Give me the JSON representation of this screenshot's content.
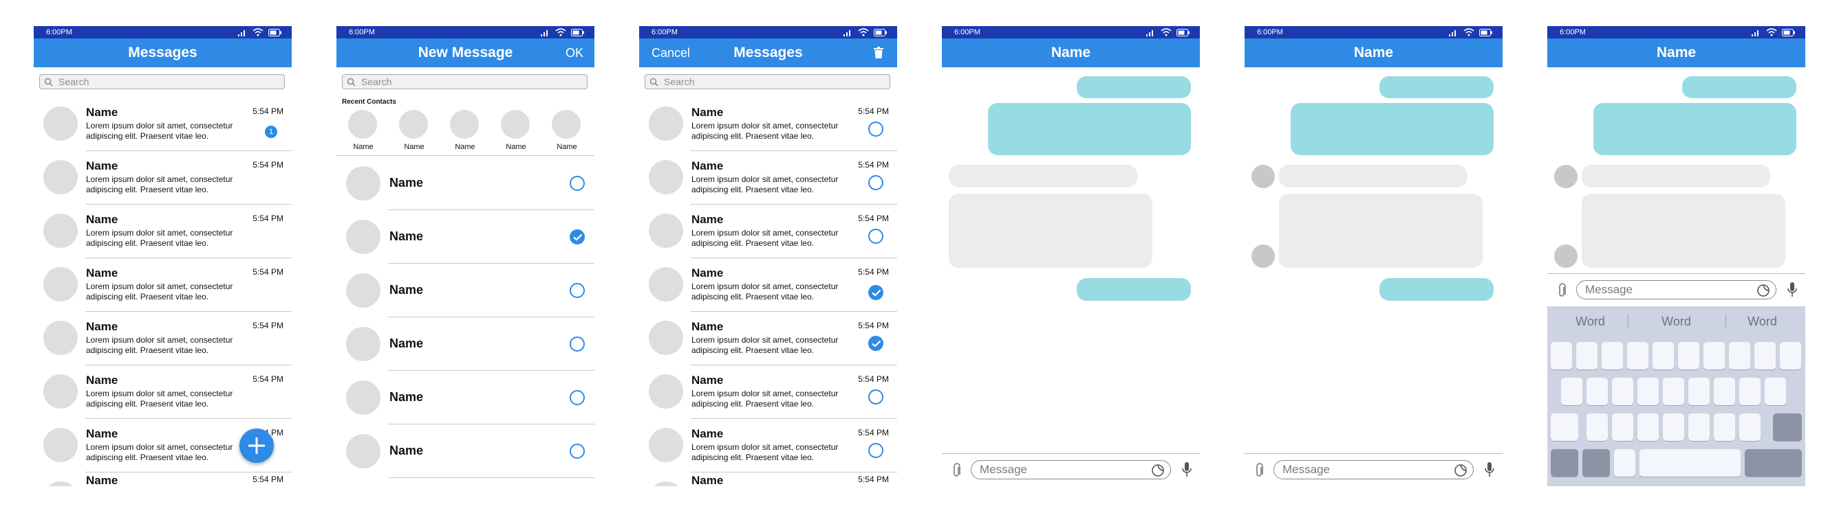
{
  "colors": {
    "statusbar": "#1b3ab0",
    "titlebar": "#2f8ae6",
    "accent": "#2f8ae6",
    "outgoing_bubble": "#97dbe3",
    "incoming_bubble": "#ececec",
    "avatar": "#dedede",
    "keyboard": "#cdd3e2"
  },
  "status": {
    "time": "6:00PM",
    "icons": [
      "signal-icon",
      "wifi-icon",
      "battery-icon"
    ]
  },
  "screen1": {
    "title": "Messages",
    "search_placeholder": "Search",
    "conversations": [
      {
        "name": "Name",
        "snippet": "Lorem ipsum dolor sit amet, consectetur adipiscing elit. Praesent vitae leo.",
        "time": "5:54 PM",
        "unread": "1"
      },
      {
        "name": "Name",
        "snippet": "Lorem ipsum dolor sit amet, consectetur adipiscing elit. Praesent vitae leo.",
        "time": "5:54 PM"
      },
      {
        "name": "Name",
        "snippet": "Lorem ipsum dolor sit amet, consectetur adipiscing elit. Praesent vitae leo.",
        "time": "5:54 PM"
      },
      {
        "name": "Name",
        "snippet": "Lorem ipsum dolor sit amet, consectetur adipiscing elit. Praesent vitae leo.",
        "time": "5:54 PM"
      },
      {
        "name": "Name",
        "snippet": "Lorem ipsum dolor sit amet, consectetur adipiscing elit. Praesent vitae leo.",
        "time": "5:54 PM"
      },
      {
        "name": "Name",
        "snippet": "Lorem ipsum dolor sit amet, consectetur adipiscing elit. Praesent vitae leo.",
        "time": "5:54 PM"
      },
      {
        "name": "Name",
        "snippet": "Lorem ipsum dolor sit amet, consectetur adipiscing elit. Praesent vitae leo.",
        "time": "5:54 PM"
      },
      {
        "name": "Name",
        "snippet": "",
        "time": "5:54 PM"
      }
    ],
    "fab_icon": "plus-icon"
  },
  "screen2": {
    "title": "New Message",
    "ok_label": "OK",
    "search_placeholder": "Search",
    "recent_label": "Recent Contacts",
    "recent_contacts": [
      "Name",
      "Name",
      "Name",
      "Name",
      "Name"
    ],
    "contacts": [
      {
        "name": "Name",
        "selected": false
      },
      {
        "name": "Name",
        "selected": true
      },
      {
        "name": "Name",
        "selected": false
      },
      {
        "name": "Name",
        "selected": false
      },
      {
        "name": "Name",
        "selected": false
      },
      {
        "name": "Name",
        "selected": false
      }
    ]
  },
  "screen3": {
    "title": "Messages",
    "cancel_label": "Cancel",
    "delete_icon": "trash-icon",
    "search_placeholder": "Search",
    "conversations": [
      {
        "name": "Name",
        "snippet": "Lorem ipsum dolor sit amet, consectetur adipiscing elit. Praesent vitae leo.",
        "time": "5:54 PM",
        "selected": false
      },
      {
        "name": "Name",
        "snippet": "Lorem ipsum dolor sit amet, consectetur adipiscing elit. Praesent vitae leo.",
        "time": "5:54 PM",
        "selected": false
      },
      {
        "name": "Name",
        "snippet": "Lorem ipsum dolor sit amet, consectetur adipiscing elit. Praesent vitae leo.",
        "time": "5:54 PM",
        "selected": false
      },
      {
        "name": "Name",
        "snippet": "Lorem ipsum dolor sit amet, consectetur adipiscing elit. Praesent vitae leo.",
        "time": "5:54 PM",
        "selected": true
      },
      {
        "name": "Name",
        "snippet": "Lorem ipsum dolor sit amet, consectetur adipiscing elit. Praesent vitae leo.",
        "time": "5:54 PM",
        "selected": true
      },
      {
        "name": "Name",
        "snippet": "Lorem ipsum dolor sit amet, consectetur adipiscing elit. Praesent vitae leo.",
        "time": "5:54 PM",
        "selected": false
      },
      {
        "name": "Name",
        "snippet": "Lorem ipsum dolor sit amet, consectetur adipiscing elit. Praesent vitae leo.",
        "time": "5:54 PM",
        "selected": false
      },
      {
        "name": "Name",
        "snippet": "",
        "time": "5:54 PM",
        "selected": false
      }
    ]
  },
  "screen4": {
    "title": "Name",
    "message_placeholder": "Message"
  },
  "screen5": {
    "title": "Name",
    "message_placeholder": "Message"
  },
  "screen6": {
    "title": "Name",
    "message_placeholder": "Message",
    "suggestions": [
      "Word",
      "Word",
      "Word"
    ]
  }
}
